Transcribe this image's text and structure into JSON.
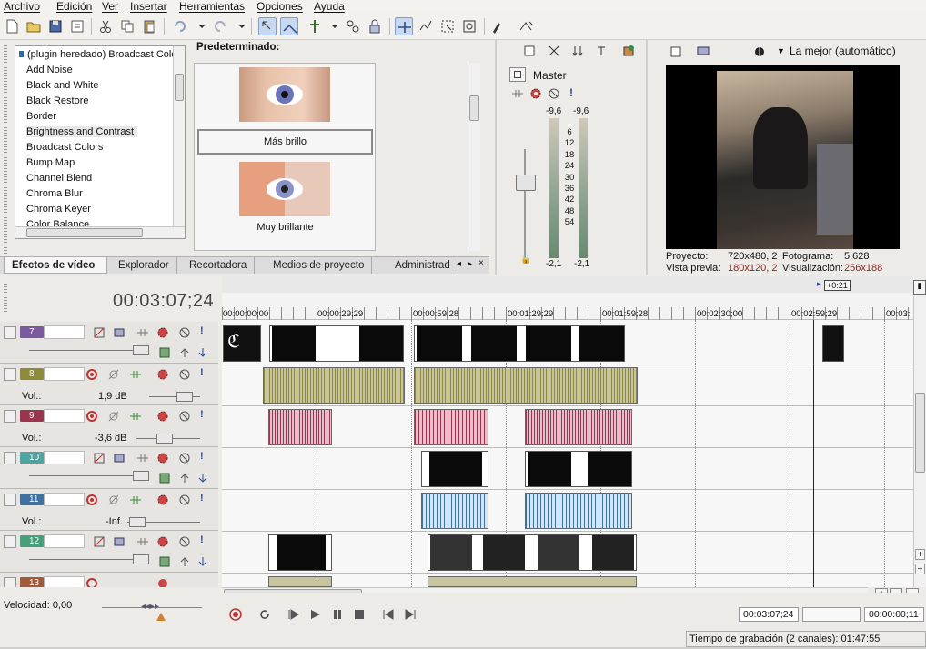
{
  "menu": [
    "Archivo",
    "Edición",
    "Ver",
    "Insertar",
    "Herramientas",
    "Opciones",
    "Ayuda"
  ],
  "fx": {
    "items": [
      "(plugin heredado) Broadcast Colo",
      "Add Noise",
      "Black and White",
      "Black Restore",
      "Border",
      "Brightness and Contrast",
      "Broadcast Colors",
      "Bump Map",
      "Channel Blend",
      "Chroma Blur",
      "Chroma Keyer",
      "Color Balance"
    ],
    "selected_index": 5
  },
  "presets": {
    "header": "Predeterminado:",
    "items": [
      "Más brillo",
      "Muy brillante"
    ]
  },
  "tabs": [
    "Efectos de vídeo",
    "Explorador",
    "Recortadora",
    "Medios de proyecto",
    "Administrad"
  ],
  "master": {
    "label": "Master",
    "peak_left": "-9,6",
    "peak_right": "-9,6",
    "scale": [
      "6",
      "12",
      "18",
      "24",
      "30",
      "36",
      "42",
      "48",
      "54"
    ],
    "bottom_left": "-2,1",
    "bottom_right": "-2,1"
  },
  "preview": {
    "quality": "La mejor (automático)",
    "proyecto_label": "Proyecto:",
    "proyecto_value": "720x480, 2",
    "fotograma_label": "Fotograma:",
    "fotograma_value": "5.628",
    "vista_label": "Vista previa:",
    "vista_value": "180x120, 2",
    "visual_label": "Visualización:",
    "visual_value": "256x188"
  },
  "timeline": {
    "timecode": "00:03:07;24",
    "marker": "+0:21",
    "ruler": [
      "00:00:00;00",
      "00:00:29;29",
      "00:00:59;28",
      "00:01:29;29",
      "00:01:59;28",
      "00:02:30;00",
      "00:02:59;29",
      "00:03:"
    ]
  },
  "tracks": [
    {
      "num": "7",
      "type": "video",
      "color": "#7b5aa0"
    },
    {
      "num": "8",
      "type": "audio",
      "color": "#8d8a3c",
      "vol_label": "Vol.:",
      "vol_value": "1,9 dB"
    },
    {
      "num": "9",
      "type": "audio",
      "color": "#9a3550",
      "vol_label": "Vol.:",
      "vol_value": "-3,6 dB"
    },
    {
      "num": "10",
      "type": "video",
      "color": "#4fa3a0"
    },
    {
      "num": "11",
      "type": "audio",
      "color": "#3f72a0",
      "vol_label": "Vol.:",
      "vol_value": "-Inf."
    },
    {
      "num": "12",
      "type": "video",
      "color": "#47a07a"
    },
    {
      "num": "13",
      "type": "audio",
      "color": "#a05a3a"
    }
  ],
  "bottom": {
    "speed": "Velocidad: 0,00",
    "tc1": "00:03:07;24",
    "tc2": "",
    "tc3": "00:00:00;11",
    "status": "Tiempo de grabación (2 canales): 01:47:55"
  },
  "icons": [
    "new-icon",
    "open-icon",
    "save-icon",
    "properties-icon",
    "cut-icon",
    "copy-icon",
    "paste-icon",
    "undo-icon",
    "redo-icon",
    "normal-edit-icon",
    "envelope-edit-icon",
    "snap-icon",
    "ripple-icon",
    "lock-icon",
    "auto-crossfade-icon",
    "zoom-icon",
    "selection-icon",
    "render-icon",
    "help-icon"
  ]
}
